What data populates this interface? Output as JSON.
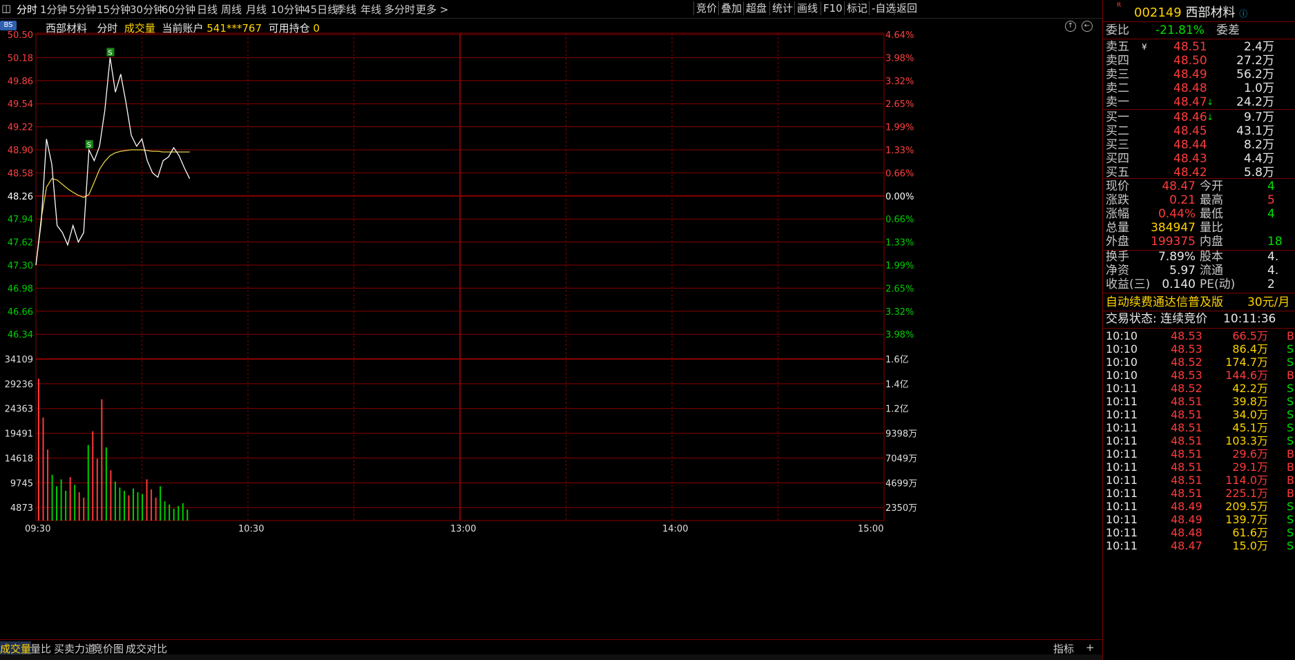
{
  "toolbar": {
    "left_icon": "◫",
    "periods": [
      "分时",
      "1分钟",
      "5分钟",
      "15分钟",
      "30分钟",
      "60分钟",
      "日线",
      "周线",
      "月线",
      "10分钟",
      "45日线",
      "季线",
      "年线",
      "多分时",
      "更多 >"
    ],
    "right_buttons": [
      "竞价",
      "叠加",
      "超盘",
      "统计",
      "画线",
      "F10",
      "标记",
      "-自选",
      "返回"
    ]
  },
  "chart": {
    "bs_badge": "BS",
    "stock_name": "西部材料",
    "mode": "分时",
    "indicator": "成交量",
    "account_label": "当前账户",
    "account_no": "541***767",
    "holdings_label": "可用持仓",
    "holdings": "0",
    "price_ticks": [
      "50.50",
      "50.18",
      "49.86",
      "49.54",
      "49.22",
      "48.90",
      "48.58",
      "48.26",
      "47.94",
      "47.62",
      "47.30",
      "46.98",
      "46.66",
      "46.34"
    ],
    "pct_ticks": [
      "4.64%",
      "3.98%",
      "3.32%",
      "2.65%",
      "1.99%",
      "1.33%",
      "0.66%",
      "0.00%",
      "0.66%",
      "1.33%",
      "1.99%",
      "2.65%",
      "3.32%",
      "3.98%"
    ],
    "vol_ticks": [
      "34109",
      "29236",
      "24363",
      "19491",
      "14618",
      "9745",
      "4873"
    ],
    "amt_ticks": [
      "1.6亿",
      "1.4亿",
      "1.2亿",
      "9398万",
      "7049万",
      "4699万",
      "2350万"
    ],
    "time_labels": [
      "09:30",
      "10:30",
      "13:00",
      "14:00",
      "15:00"
    ],
    "trade_marks": [
      "S",
      "S"
    ],
    "colors": {
      "grid": "#8a0000",
      "price_line": "#ffffff",
      "avg_line": "#e6d24a",
      "up_bar": "#ff3b3b",
      "down_bar": "#00d000",
      "axis_up": "#ff4040",
      "axis_down": "#00d000",
      "axis_flat": "#ffffff"
    }
  },
  "chart_data": {
    "type": "line",
    "prev_close": 48.26,
    "price_range": [
      46.02,
      50.5
    ],
    "series": [
      {
        "name": "price",
        "values": [
          47.3,
          47.9,
          49.05,
          48.7,
          47.85,
          47.75,
          47.58,
          47.85,
          47.62,
          47.75,
          48.9,
          48.75,
          48.95,
          49.45,
          50.18,
          49.7,
          49.95,
          49.55,
          49.1,
          48.95,
          49.05,
          48.75,
          48.58,
          48.52,
          48.75,
          48.8,
          48.93,
          48.82,
          48.65,
          48.5
        ]
      },
      {
        "name": "avg",
        "values": [
          47.3,
          47.95,
          48.38,
          48.5,
          48.48,
          48.42,
          48.36,
          48.31,
          48.27,
          48.24,
          48.28,
          48.45,
          48.63,
          48.74,
          48.82,
          48.86,
          48.88,
          48.89,
          48.9,
          48.9,
          48.9,
          48.89,
          48.88,
          48.88,
          48.87,
          48.87,
          48.87,
          48.87,
          48.87,
          48.87
        ]
      },
      {
        "name": "volume",
        "values": [
          31000,
          22500,
          15500,
          10000,
          7500,
          9000,
          6500,
          9500,
          7800,
          6200,
          5000,
          16500,
          19500,
          13500,
          26500,
          16000,
          11000,
          8500,
          7200,
          6500,
          5500,
          7000,
          6200,
          5800,
          9000,
          6800,
          5000,
          7500,
          4200,
          3500,
          2600,
          3200,
          3800,
          2400
        ]
      }
    ],
    "volume_max": 34109
  },
  "order_book": {
    "stock_code": "002149",
    "stock_name": "西部材料",
    "ratio_label": "委比",
    "ratio_value": "-21.81%",
    "diff_label": "委差",
    "asks": [
      {
        "label": "卖五",
        "price": "48.51",
        "vol": "2.4万",
        "mark": "¥"
      },
      {
        "label": "卖四",
        "price": "48.50",
        "vol": "27.2万",
        "mark": ""
      },
      {
        "label": "卖三",
        "price": "48.49",
        "vol": "56.2万",
        "mark": ""
      },
      {
        "label": "卖二",
        "price": "48.48",
        "vol": "1.0万",
        "mark": ""
      },
      {
        "label": "卖一",
        "price": "48.47",
        "vol": "24.2万",
        "mark": "↓"
      }
    ],
    "bids": [
      {
        "label": "买一",
        "price": "48.46",
        "vol": "9.7万",
        "mark": "↓"
      },
      {
        "label": "买二",
        "price": "48.45",
        "vol": "43.1万",
        "mark": ""
      },
      {
        "label": "买三",
        "price": "48.44",
        "vol": "8.2万",
        "mark": ""
      },
      {
        "label": "买四",
        "price": "48.43",
        "vol": "4.4万",
        "mark": ""
      },
      {
        "label": "买五",
        "price": "48.42",
        "vol": "5.8万",
        "mark": ""
      }
    ]
  },
  "quote": {
    "rows": [
      {
        "l1": "现价",
        "v1": "48.47",
        "c1": "red",
        "l2": "今开",
        "v2": "4",
        "c2": "green"
      },
      {
        "l1": "涨跌",
        "v1": "0.21",
        "c1": "red",
        "l2": "最高",
        "v2": "5",
        "c2": "red"
      },
      {
        "l1": "涨幅",
        "v1": "0.44%",
        "c1": "red",
        "l2": "最低",
        "v2": "4",
        "c2": "green"
      },
      {
        "l1": "总量",
        "v1": "384947",
        "c1": "yellow",
        "l2": "量比",
        "v2": "",
        "c2": "white"
      },
      {
        "l1": "外盘",
        "v1": "199375",
        "c1": "red",
        "l2": "内盘",
        "v2": "18",
        "c2": "green"
      }
    ],
    "rows2": [
      {
        "l1": "换手",
        "v1": "7.89%",
        "c1": "white",
        "l2": "股本",
        "v2": "4.",
        "c2": "white"
      },
      {
        "l1": "净资",
        "v1": "5.97",
        "c1": "white",
        "l2": "流通",
        "v2": "4.",
        "c2": "white"
      },
      {
        "l1": "收益(三)",
        "v1": "0.140",
        "c1": "white",
        "l2": "PE(动)",
        "v2": "2",
        "c2": "white"
      }
    ]
  },
  "promo": {
    "text": "自动续费通达信普及版",
    "price": "30元/月"
  },
  "trade_status": {
    "label": "交易状态:",
    "value": "连续竞价",
    "time": "10:11:36"
  },
  "ticks": [
    {
      "t": "10:10",
      "p": "48.53",
      "v": "66.5万",
      "d": "B"
    },
    {
      "t": "10:10",
      "p": "48.53",
      "v": "86.4万",
      "d": "S"
    },
    {
      "t": "10:10",
      "p": "48.52",
      "v": "174.7万",
      "d": "S"
    },
    {
      "t": "10:10",
      "p": "48.53",
      "v": "144.6万",
      "d": "B"
    },
    {
      "t": "10:11",
      "p": "48.52",
      "v": "42.2万",
      "d": "S"
    },
    {
      "t": "10:11",
      "p": "48.51",
      "v": "39.8万",
      "d": "S"
    },
    {
      "t": "10:11",
      "p": "48.51",
      "v": "34.0万",
      "d": "S"
    },
    {
      "t": "10:11",
      "p": "48.51",
      "v": "45.1万",
      "d": "S"
    },
    {
      "t": "10:11",
      "p": "48.51",
      "v": "103.3万",
      "d": "S"
    },
    {
      "t": "10:11",
      "p": "48.51",
      "v": "29.6万",
      "d": "B"
    },
    {
      "t": "10:11",
      "p": "48.51",
      "v": "29.1万",
      "d": "B"
    },
    {
      "t": "10:11",
      "p": "48.51",
      "v": "114.0万",
      "d": "B"
    },
    {
      "t": "10:11",
      "p": "48.51",
      "v": "225.1万",
      "d": "B"
    },
    {
      "t": "10:11",
      "p": "48.49",
      "v": "209.5万",
      "d": "S"
    },
    {
      "t": "10:11",
      "p": "48.49",
      "v": "139.7万",
      "d": "S"
    },
    {
      "t": "10:11",
      "p": "48.48",
      "v": "61.6万",
      "d": "S"
    },
    {
      "t": "10:11",
      "p": "48.47",
      "v": "15.0万",
      "d": "S"
    }
  ],
  "bottom_tabs": [
    "成交量",
    "量比",
    "买卖力道",
    "竞价图",
    "成交对比"
  ],
  "bottom_right": {
    "indicator": "指标",
    "plus": "+",
    "minus": "-"
  }
}
